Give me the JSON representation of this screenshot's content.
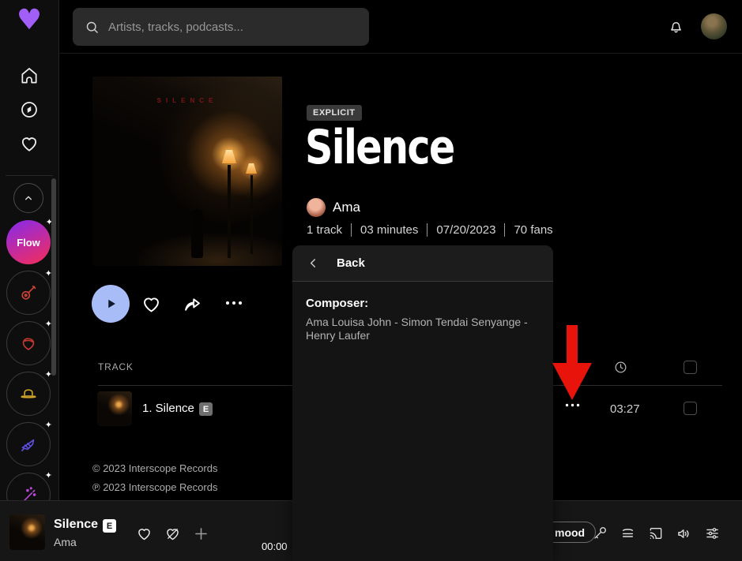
{
  "topbar": {
    "search_placeholder": "Artists, tracks, podcasts..."
  },
  "sidebar": {
    "flow_label": "Flow",
    "pin_glyph": "✦"
  },
  "hero": {
    "explicit_badge": "EXPLICIT",
    "title": "Silence",
    "artist": "Ama",
    "art_caption": "SILENCE",
    "stats": {
      "tracks": "1 track",
      "minutes": "03 minutes",
      "date": "07/20/2023",
      "fans": "70 fans"
    }
  },
  "panel": {
    "back_label": "Back",
    "composer_label": "Composer:",
    "composer_names": "Ama Louisa John - Simon Tendai Senyange - Henry Laufer"
  },
  "tracklist": {
    "header": "TRACK",
    "row": {
      "title": "1. Silence",
      "explicit_badge": "E",
      "duration": "03:27"
    }
  },
  "credits": {
    "line1": "© 2023 Interscope Records",
    "line2": "℗ 2023 Interscope Records"
  },
  "player": {
    "title": "Silence",
    "explicit_badge": "E",
    "artist": "Ama",
    "elapsed": "00:00",
    "mood_label": "mood"
  },
  "colors": {
    "accent_purple": "#a25ff7",
    "play_button_blue": "#a8bcf8",
    "arrow_red": "#e8140c",
    "flow_gradient": [
      "#8f2be0",
      "#ef2d5e"
    ]
  }
}
